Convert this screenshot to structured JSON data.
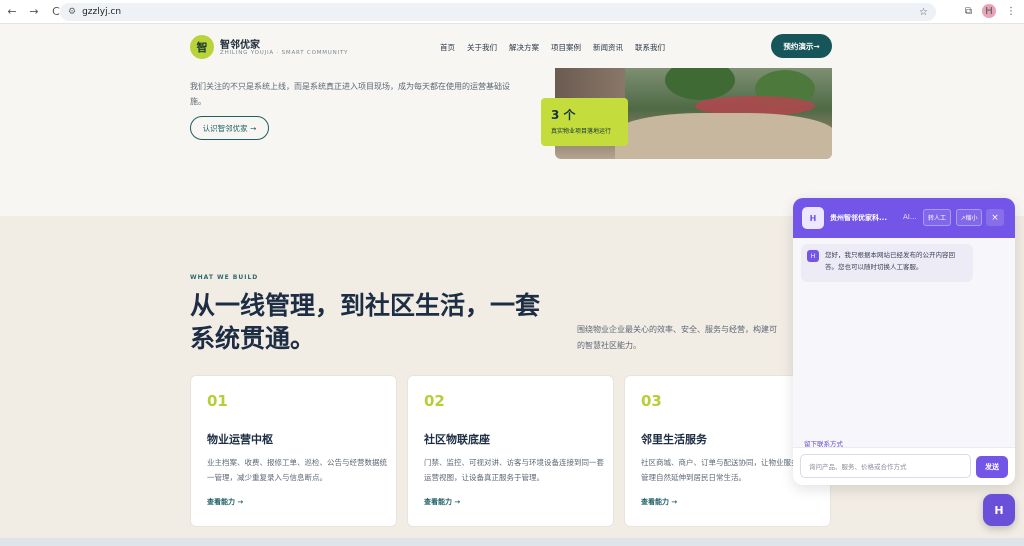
{
  "browser": {
    "back": "←",
    "forward": "→",
    "reload": "C",
    "url": "gzzlyj.cn",
    "profile_initial": "H"
  },
  "header": {
    "logo_mark": "智",
    "logo_name": "智邻优家",
    "logo_sub": "ZHILING YOUJIA · SMART COMMUNITY",
    "nav": [
      "首页",
      "关于我们",
      "解决方案",
      "项目案例",
      "新闻资讯",
      "联系我们"
    ],
    "cta": "预约演示→"
  },
  "hero": {
    "text": "我们关注的不只是系统上线，而是系统真正进入项目现场，成为每天都在使用的运营基础设施。",
    "button": "认识智邻优家 →",
    "stat_number": "3 个",
    "stat_label": "真实物业项目落地运行"
  },
  "section": {
    "eyebrow": "WHAT WE BUILD",
    "headline": "从一线管理，到社区生活，一套系统贯通。",
    "description_line1": "围绕物业企业最关心的效率、安全、服务与经营，构建可",
    "description_line2": "的智慧社区能力。",
    "cards": [
      {
        "num": "01",
        "title": "物业运营中枢",
        "desc": "业主档案、收费、报修工单、巡检、公告与经营数据统一管理，减少重复录入与信息断点。",
        "link": "查看能力 →"
      },
      {
        "num": "02",
        "title": "社区物联底座",
        "desc": "门禁、监控、可视对讲、访客与环境设备连接到同一套运营视图，让设备真正服务于管理。",
        "link": "查看能力 →"
      },
      {
        "num": "03",
        "title": "邻里生活服务",
        "desc": "社区商城、商户、订单与配送协同，让物业服务从基础管理自然延伸到居民日常生活。",
        "link": "查看能力 →"
      }
    ]
  },
  "chat": {
    "avatar": "H",
    "title": "贵州智邻优家科...",
    "title_suffix": "AI...",
    "human_btn": "转人工",
    "collapse_btn": "↗缩小",
    "close": "×",
    "message": "您好，我只根据本网站已经发布的公开内容回答。您也可以随时切换人工客服。",
    "leave_contact": "留下联系方式",
    "input_placeholder": "询问产品、服务、价格或合作方式",
    "send": "发送",
    "fab": "H"
  },
  "colors": {
    "brand_teal": "#16565b",
    "accent_lime": "#c4dd3c",
    "chat_purple": "#7356e8"
  }
}
